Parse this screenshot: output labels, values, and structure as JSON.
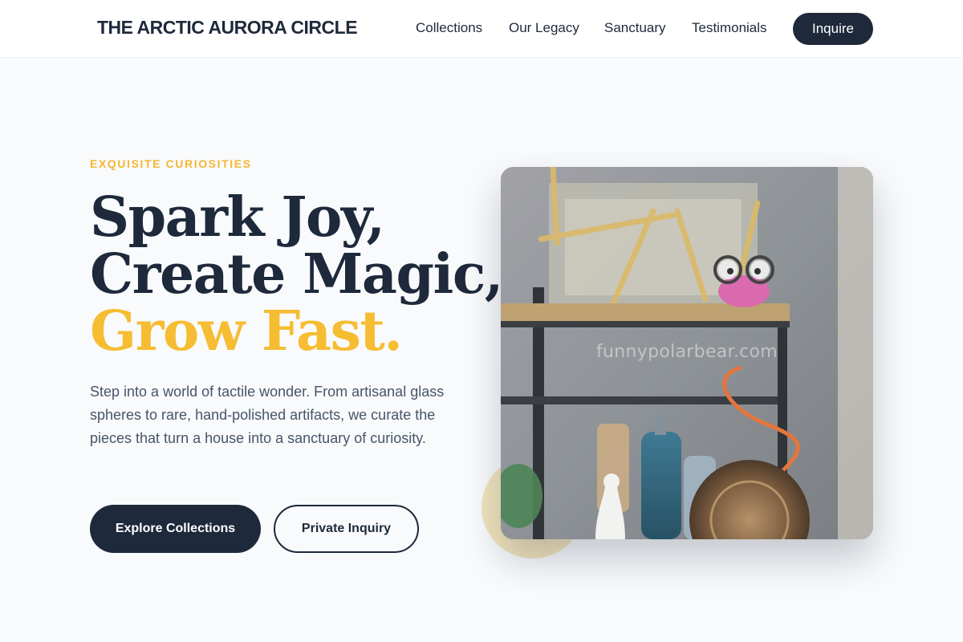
{
  "header": {
    "brand": "THE ARCTIC AURORA CIRCLE",
    "nav": [
      "Collections",
      "Our Legacy",
      "Sanctuary",
      "Testimonials"
    ],
    "cta": "Inquire"
  },
  "hero": {
    "eyebrow": "EXQUISITE CURIOSITIES",
    "headline": {
      "line1": "Spark Joy,",
      "line2": "Create Magic,",
      "line3": "Grow Fast."
    },
    "intro": "Step into a world of tactile wonder. From artisanal glass spheres to rare, hand-polished artifacts, we curate the pieces that turn a house into a sanctuary of curiosity.",
    "primary_button": "Explore Collections",
    "secondary_button": "Private Inquiry",
    "image_watermark": "funnypolarbear.com"
  },
  "colors": {
    "navy": "#1e293b",
    "gold": "#f6bd33",
    "page_background": "#f8fafc",
    "body_text": "#475569"
  }
}
